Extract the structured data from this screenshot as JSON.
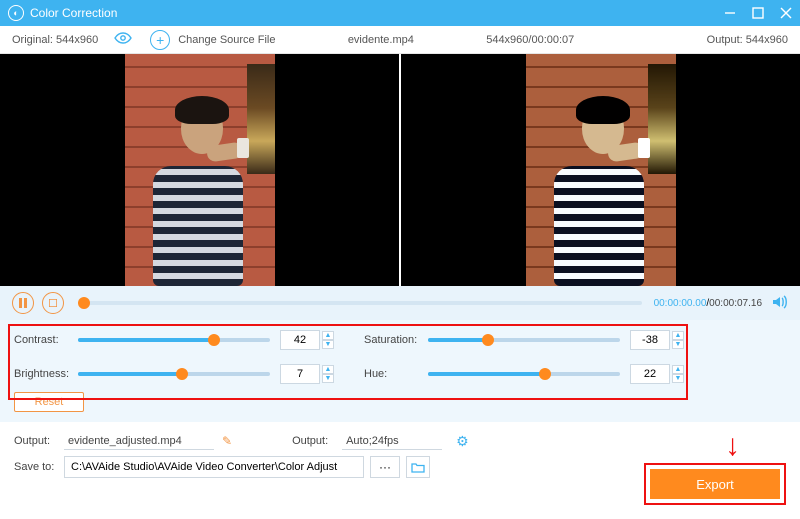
{
  "titlebar": {
    "title": "Color Correction"
  },
  "infobar": {
    "original_label": "Original: 544x960",
    "change_source": "Change Source File",
    "filename": "evidente.mp4",
    "src_meta": "544x960/00:00:07",
    "output_label": "Output: 544x960"
  },
  "playback": {
    "current": "00:00:00.00",
    "sep": "/",
    "duration": "00:00:07.16"
  },
  "sliders": {
    "contrast": {
      "label": "Contrast:",
      "value": "42",
      "percent": 71
    },
    "saturation": {
      "label": "Saturation:",
      "value": "-38",
      "percent": 31
    },
    "brightness": {
      "label": "Brightness:",
      "value": "7",
      "percent": 54
    },
    "hue": {
      "label": "Hue:",
      "value": "22",
      "percent": 61
    }
  },
  "reset_label": "Reset",
  "outputs": {
    "name_label": "Output:",
    "name_value": "evidente_adjusted.mp4",
    "fmt_label": "Output:",
    "fmt_value": "Auto;24fps",
    "save_label": "Save to:",
    "save_path": "C:\\AVAide Studio\\AVAide Video Converter\\Color Adjust",
    "dots": "···"
  },
  "export_label": "Export"
}
